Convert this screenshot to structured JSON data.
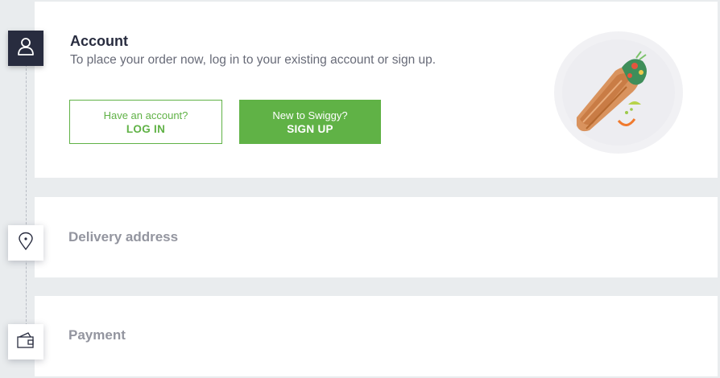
{
  "account": {
    "title": "Account",
    "subtitle": "To place your order now, log in to your existing account or sign up.",
    "login": {
      "prompt": "Have an account?",
      "label": "LOG IN"
    },
    "signup": {
      "prompt": "New to Swiggy?",
      "label": "SIGN UP"
    }
  },
  "delivery": {
    "title": "Delivery address"
  },
  "payment": {
    "title": "Payment"
  },
  "icons": {
    "account": "user-icon",
    "delivery": "location-pin-icon",
    "payment": "wallet-icon",
    "illustration": "food-wrap-illustration"
  },
  "colors": {
    "accent_green": "#60b246",
    "dark_navy": "#282c3f",
    "muted_text": "#686b78",
    "inactive_title": "#93959f"
  }
}
